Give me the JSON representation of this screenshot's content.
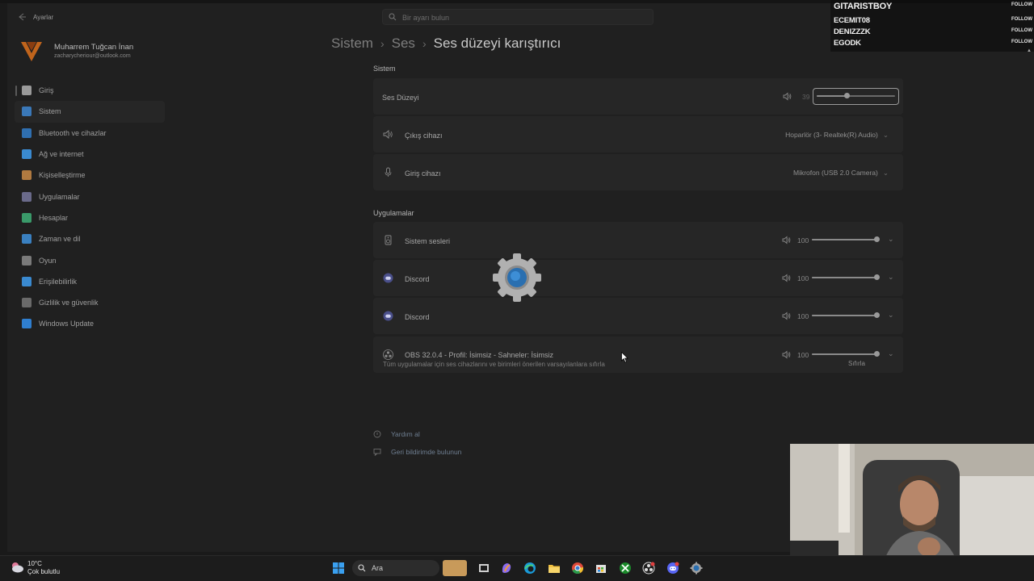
{
  "window": {
    "app_title": "Ayarlar",
    "search_placeholder": "Bir ayarı bulun"
  },
  "user": {
    "name": "Muharrem Tuğcan İnan",
    "email": "zacharycheriour@outlook.com"
  },
  "sidebar": {
    "items": [
      {
        "label": "Giriş",
        "icon": "home-icon",
        "color": "#9a9a9a"
      },
      {
        "label": "Sistem",
        "icon": "system-icon",
        "color": "#3a78b8"
      },
      {
        "label": "Bluetooth ve cihazlar",
        "icon": "bluetooth-icon",
        "color": "#2f6fb0"
      },
      {
        "label": "Ağ ve internet",
        "icon": "network-icon",
        "color": "#3a8ad0"
      },
      {
        "label": "Kişiselleştirme",
        "icon": "brush-icon",
        "color": "#b07a40"
      },
      {
        "label": "Uygulamalar",
        "icon": "apps-icon",
        "color": "#6a6a8a"
      },
      {
        "label": "Hesaplar",
        "icon": "accounts-icon",
        "color": "#3a9a6a"
      },
      {
        "label": "Zaman ve dil",
        "icon": "time-language-icon",
        "color": "#3a80c0"
      },
      {
        "label": "Oyun",
        "icon": "gamepad-icon",
        "color": "#7a7a7a"
      },
      {
        "label": "Erişilebilirlik",
        "icon": "accessibility-icon",
        "color": "#3a8ad0"
      },
      {
        "label": "Gizlilik ve güvenlik",
        "icon": "shield-icon",
        "color": "#6a6a6a"
      },
      {
        "label": "Windows Update",
        "icon": "update-icon",
        "color": "#2f7fd0"
      }
    ]
  },
  "breadcrumb": {
    "part1": "Sistem",
    "part2": "Ses",
    "current": "Ses düzeyi karıştırıcı"
  },
  "system_section": {
    "title": "Sistem",
    "volume": {
      "label": "Ses Düzeyi",
      "value": "39",
      "level_percent": 39
    },
    "output": {
      "label": "Çıkış cihazı",
      "device": "Hoparlör (3- Realtek(R) Audio)"
    },
    "input": {
      "label": "Giriş cihazı",
      "device": "Mikrofon (USB 2.0 Camera)"
    }
  },
  "apps_section": {
    "title": "Uygulamalar",
    "apps": [
      {
        "name": "Sistem sesleri",
        "icon": "speaker-device-icon",
        "volume": "100",
        "level_percent": 100
      },
      {
        "name": "Discord",
        "icon": "discord-icon",
        "volume": "100",
        "level_percent": 100
      },
      {
        "name": "Discord",
        "icon": "discord-icon",
        "volume": "100",
        "level_percent": 100
      },
      {
        "name": "OBS 32.0.4 - Profil: İsimsiz - Sahneler: İsimsiz",
        "icon": "obs-icon",
        "volume": "100",
        "level_percent": 100
      }
    ],
    "reset_note": "Tüm uygulamalar için ses cihazlarını ve birimleri önerilen varsayılanlara sıfırla",
    "reset_button": "Sıfırla"
  },
  "help": {
    "get_help": "Yardım al",
    "feedback": "Geri bildirimde bulunun"
  },
  "overlay": {
    "followers": [
      {
        "name": "GITARISTBOY",
        "action": "FOLLOW"
      },
      {
        "name": "ECEMIT08",
        "action": "FOLLOW"
      },
      {
        "name": "DENIZZZK",
        "action": "FOLLOW"
      },
      {
        "name": "EGODK",
        "action": "FOLLOW"
      }
    ]
  },
  "taskbar": {
    "weather_temp": "10°C",
    "weather_desc": "Çok bulutlu",
    "search_label": "Ara"
  },
  "colors": {
    "background": "#202020",
    "card": "#262626",
    "accent": "#4a8ad0"
  }
}
